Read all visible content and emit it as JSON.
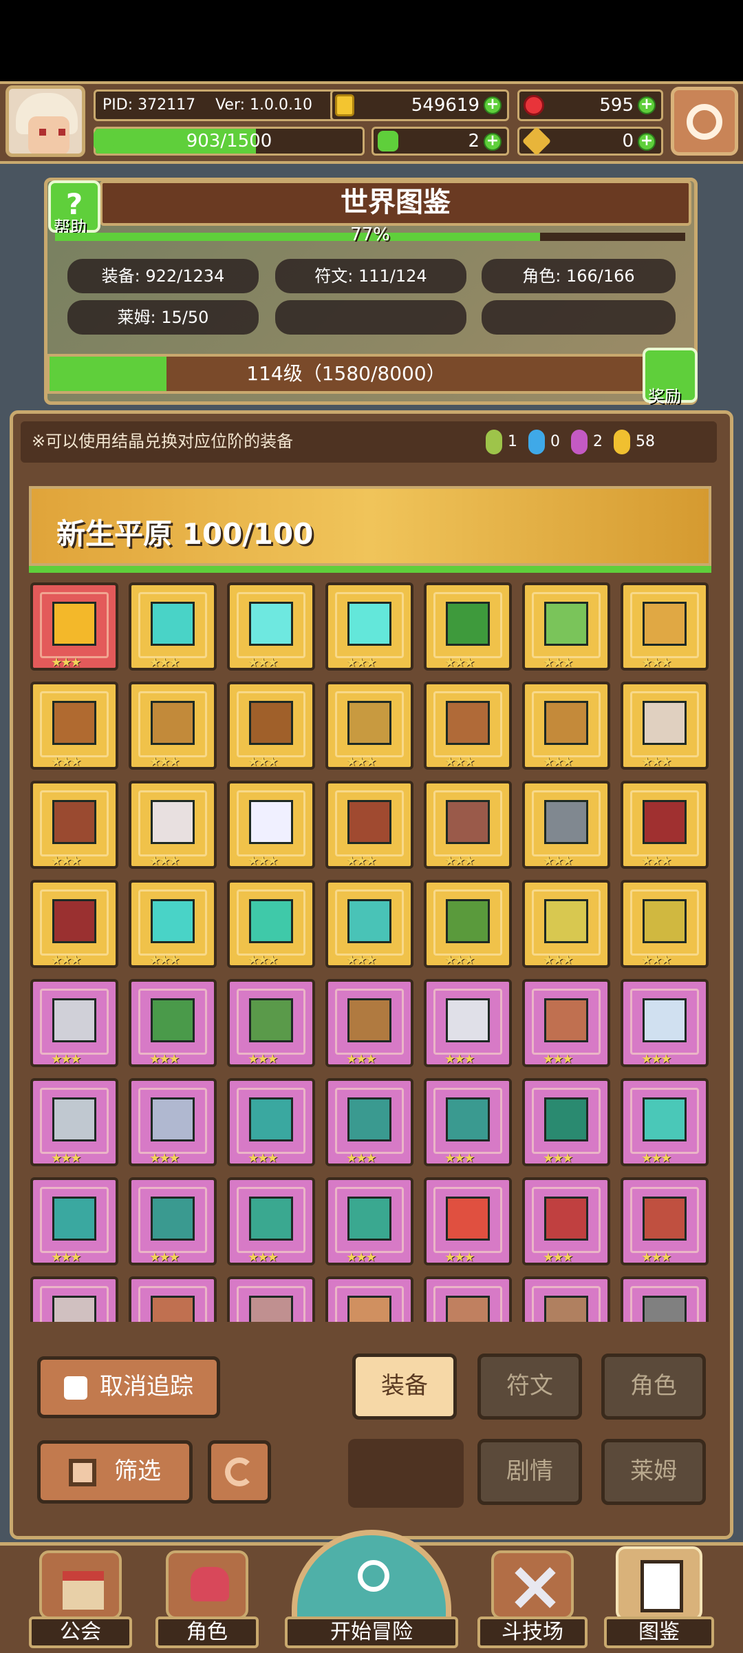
{
  "header": {
    "pid": "PID: 372117",
    "version": "Ver: 1.0.0.10",
    "gold": "549619",
    "gems": "595",
    "energy": "903/1500",
    "clover": "2",
    "keys": "0"
  },
  "codex": {
    "title": "世界图鉴",
    "help_label": "帮助",
    "percent": "77%",
    "percent_value": 0.77,
    "stats": [
      {
        "label": "装备: 922/1234"
      },
      {
        "label": "符文: 111/124"
      },
      {
        "label": "角色: 166/166"
      },
      {
        "label": "莱姆: 15/50"
      },
      {
        "label": ""
      },
      {
        "label": ""
      }
    ],
    "level_text": "114级（1580/8000）",
    "level_fraction": 0.1975,
    "reward_label": "奖励"
  },
  "notice": "※可以使用结晶兑换对应位阶的装备",
  "crystals": [
    {
      "color": "#9ec44a",
      "count": "1"
    },
    {
      "color": "#3fa9e8",
      "count": "0"
    },
    {
      "color": "#c45ac4",
      "count": "2"
    },
    {
      "color": "#f0c030",
      "count": "58"
    }
  ],
  "region": {
    "title": "新生平原  100/100"
  },
  "grid_rows": [
    [
      "red",
      "gold",
      "gold",
      "gold",
      "gold",
      "gold",
      "gold"
    ],
    [
      "gold",
      "gold",
      "gold",
      "gold",
      "gold",
      "gold",
      "gold"
    ],
    [
      "gold",
      "gold",
      "gold",
      "gold",
      "gold",
      "gold",
      "gold"
    ],
    [
      "gold",
      "gold",
      "gold",
      "gold",
      "gold",
      "gold",
      "gold"
    ],
    [
      "pink",
      "pink",
      "pink",
      "pink",
      "pink",
      "pink",
      "pink"
    ],
    [
      "pink",
      "pink",
      "pink",
      "pink",
      "pink",
      "pink",
      "pink"
    ],
    [
      "pink",
      "pink",
      "pink",
      "pink",
      "pink",
      "pink",
      "pink"
    ],
    [
      "pink",
      "pink",
      "pink",
      "pink",
      "pink",
      "pink",
      "pink"
    ]
  ],
  "item_colors": [
    [
      "#f3b82a",
      "#49d3c7",
      "#6ee8e0",
      "#63e7da",
      "#3e9a3c",
      "#7ac45a",
      "#e0a844"
    ],
    [
      "#b06a30",
      "#c28a3a",
      "#a0602a",
      "#c89a40",
      "#b06a38",
      "#c48a3a",
      "#e0d0c0"
    ],
    [
      "#9a4a30",
      "#e8e0e0",
      "#f0f0ff",
      "#a04a30",
      "#9a5a4a",
      "#808890",
      "#a03030"
    ],
    [
      "#9a3030",
      "#49d3c7",
      "#3fc9a9",
      "#49c3b7",
      "#5a9a3c",
      "#d8c850",
      "#d0b840"
    ],
    [
      "#d0d0d8",
      "#4a9a4a",
      "#5a9a4a",
      "#b07a40",
      "#e0e0e8",
      "#c07050",
      "#d0e0f0"
    ],
    [
      "#c0c8d0",
      "#b0b8d0",
      "#3aa8a0",
      "#3a9a90",
      "#3a9a90",
      "#2a8a70",
      "#4ac8b8"
    ],
    [
      "#3aa8a0",
      "#3a9a90",
      "#3aa890",
      "#3aa890",
      "#e05040",
      "#c04040",
      "#c05040"
    ],
    [
      "#d0c0c0",
      "#c07050",
      "#c09090",
      "#d09060",
      "#c08060",
      "#b08060",
      "#808080"
    ]
  ],
  "stars": "★★★",
  "buttons": {
    "cancel_track": "取消追踪",
    "equip": "装备",
    "rune": "符文",
    "role": "角色",
    "filter": "筛选",
    "story": "剧情",
    "slime": "莱姆"
  },
  "nav": {
    "guild": "公会",
    "role": "角色",
    "adventure": "开始冒险",
    "arena": "斗技场",
    "codex": "图鉴"
  }
}
